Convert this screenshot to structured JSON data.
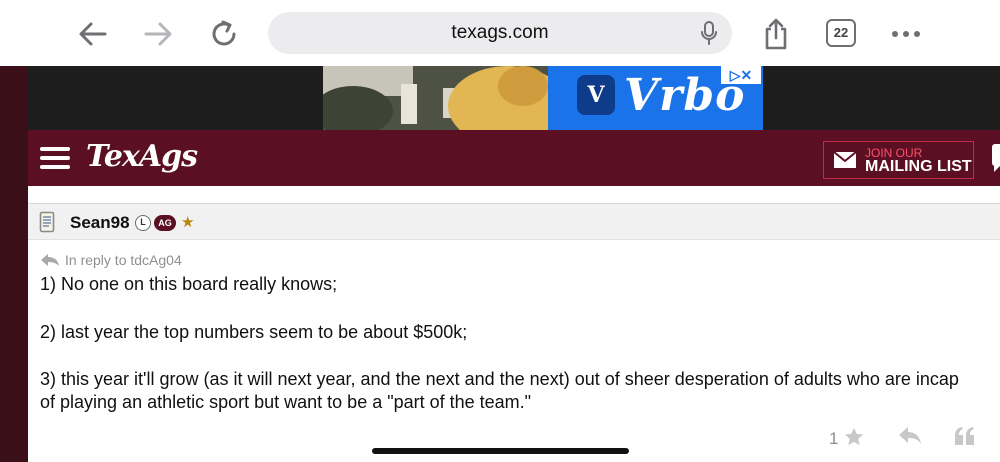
{
  "browser": {
    "url": "texags.com",
    "tab_count": "22"
  },
  "ad": {
    "brand": "Vrbo",
    "logo_letter": "V",
    "adchoice": "▷✕"
  },
  "site": {
    "logo": "TexAgs",
    "mailing_top": "JOIN OUR",
    "mailing_bottom": "MAILING LIST"
  },
  "post": {
    "username": "Sean98",
    "badge_l": "L",
    "badge_ag": "AG",
    "star": "★",
    "reply_to": "In reply to tdcAg04",
    "lines": [
      "1) No one on this board really knows;",
      "2) last year the top numbers seem to be about $500k;",
      "3) this year it'll grow (as it will next year, and the next and the next) out of sheer desperation of adults who are incap",
      "of playing an athletic sport but want to be a \"part of the team.\""
    ],
    "like_count": "1"
  },
  "colors": {
    "maroon": "#5a0f22",
    "dark_rail": "#3a0f17",
    "ad_blue": "#1a73e8"
  }
}
